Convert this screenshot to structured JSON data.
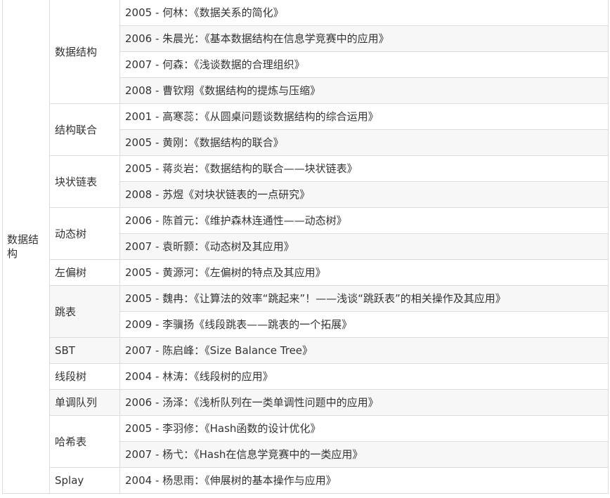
{
  "category": "数据结构",
  "groups": [
    {
      "topic": "数据结构",
      "papers": [
        "2005 - 何林：《数据关系的简化》",
        "2006 - 朱晨光：《基本数据结构在信息学竞赛中的应用》",
        "2007 - 何森：《浅谈数据的合理组织》",
        "2008 - 曹钦翔《数据结构的提炼与压缩》"
      ]
    },
    {
      "topic": "结构联合",
      "papers": [
        "2001 - 高寒蕊：《从圆桌问题谈数据结构的综合运用》",
        "2005 - 黄刚：《数据结构的联合》"
      ]
    },
    {
      "topic": "块状链表",
      "papers": [
        "2005 - 蒋炎岩：《数据结构的联合——块状链表》",
        "2008 - 苏煜《对块状链表的一点研究》"
      ]
    },
    {
      "topic": "动态树",
      "papers": [
        "2006 - 陈首元：《维护森林连通性——动态树》",
        "2007 - 袁昕颢：《动态树及其应用》"
      ]
    },
    {
      "topic": "左偏树",
      "papers": [
        "2005 - 黄源河：《左偏树的特点及其应用》"
      ]
    },
    {
      "topic": "跳表",
      "papers": [
        "2005 - 魏冉：《让算法的效率“跳起来”！——浅谈“跳跃表”的相关操作及其应用》",
        "2009 - 李骥扬《线段跳表——跳表的一个拓展》"
      ]
    },
    {
      "topic": "SBT",
      "papers": [
        "2007 - 陈启峰：《Size Balance Tree》"
      ]
    },
    {
      "topic": "线段树",
      "papers": [
        "2004 - 林涛：《线段树的应用》"
      ]
    },
    {
      "topic": "单调队列",
      "papers": [
        "2006 - 汤泽：《浅析队列在一类单调性问题中的应用》"
      ]
    },
    {
      "topic": "哈希表",
      "papers": [
        "2005 - 李羽修：《Hash函数的设计优化》",
        "2007 - 杨弋：《Hash在信息学竞赛中的一类应用》"
      ]
    },
    {
      "topic": "Splay",
      "papers": [
        "2004 - 杨思雨：《伸展树的基本操作与应用》"
      ]
    }
  ]
}
